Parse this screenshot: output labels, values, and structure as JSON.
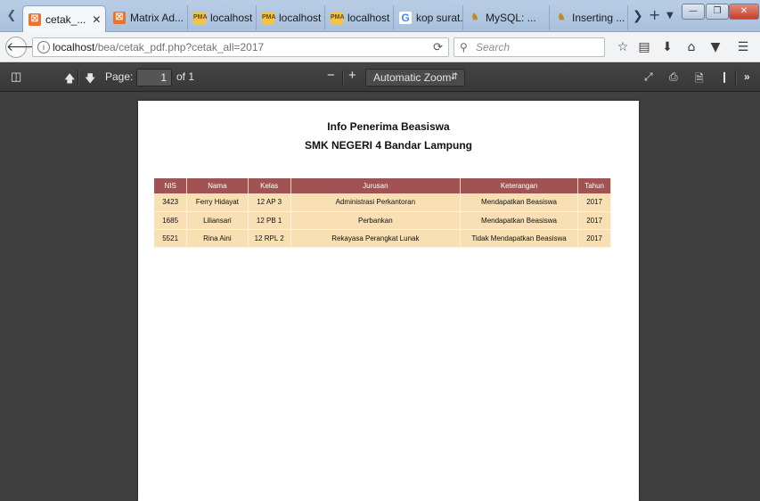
{
  "browser": {
    "tabs": [
      {
        "label": "cetak_...",
        "favicon": "x-icon",
        "active": true
      },
      {
        "label": "Matrix Ad...",
        "favicon": "x-icon"
      },
      {
        "label": "localhost ...",
        "favicon": "pma-icon"
      },
      {
        "label": "localhost ...",
        "favicon": "pma-icon"
      },
      {
        "label": "localhost ...",
        "favicon": "pma-icon"
      },
      {
        "label": "kop surat...",
        "favicon": "google-icon"
      },
      {
        "label": "MySQL: ...",
        "favicon": "mysql-icon"
      },
      {
        "label": "Inserting ...",
        "favicon": "mysql-icon"
      }
    ],
    "url_host": "localhost",
    "url_path": "/bea/cetak_pdf.php?cetak_all=2017",
    "search_placeholder": "Search"
  },
  "pdf_toolbar": {
    "page_label": "Page:",
    "page_value": "1",
    "page_count": "of 1",
    "zoom_label": "Automatic Zoom"
  },
  "document": {
    "title": "Info Penerima Beasiswa",
    "subtitle": "SMK NEGERI 4 Bandar Lampung",
    "table": {
      "headers": [
        "NIS",
        "Nama",
        "Kelas",
        "Jurusan",
        "Keterangan",
        "Tahun"
      ],
      "rows": [
        [
          "3423",
          "Ferry Hidayat",
          "12 AP 3",
          "Administrasi Perkantoran",
          "Mendapatkan Beasiswa",
          "2017"
        ],
        [
          "1685",
          "Liliansari",
          "12 PB 1",
          "Perbankan",
          "Mendapatkan Beasiswa",
          "2017"
        ],
        [
          "5521",
          "Rina Aini",
          "12 RPL 2",
          "Rekayasa Perangkat Lunak",
          "Tidak Mendapatkan Beasiswa",
          "2017"
        ]
      ]
    }
  },
  "colors": {
    "table_header_bg": "#a15353",
    "table_row_bg": "#f9dfb4",
    "viewer_bg": "#404040"
  }
}
